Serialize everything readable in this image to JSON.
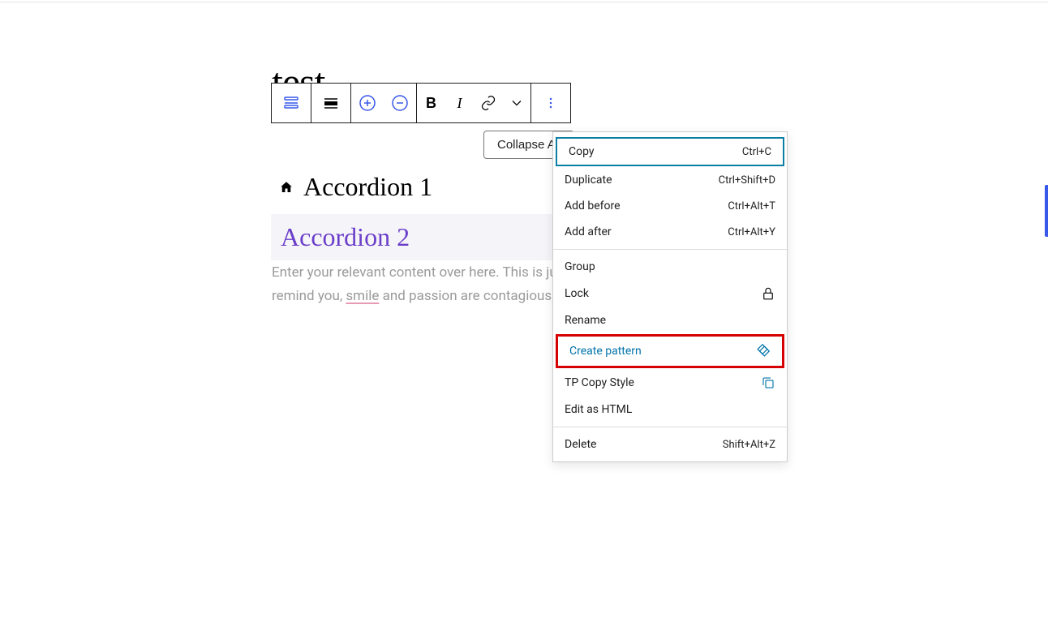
{
  "page": {
    "title": "test"
  },
  "toolbar": {
    "icons": [
      "block-type",
      "align",
      "add",
      "remove",
      "bold",
      "italic",
      "link",
      "dropdown",
      "more"
    ]
  },
  "collapse": {
    "label": "Collapse All"
  },
  "accordion1": {
    "label": "Accordion 1"
  },
  "accordion2": {
    "heading": "Accordion 2"
  },
  "content": {
    "text_before": "Enter your relevant content over here. This is ju",
    "text_line2_before": "remind you, ",
    "smile": "smile",
    "text_after": " and passion are contagious, b"
  },
  "menu": {
    "sections": [
      {
        "items": [
          {
            "label": "Copy",
            "shortcut": "Ctrl+C",
            "selected": true
          },
          {
            "label": "Duplicate",
            "shortcut": "Ctrl+Shift+D"
          },
          {
            "label": "Add before",
            "shortcut": "Ctrl+Alt+T"
          },
          {
            "label": "Add after",
            "shortcut": "Ctrl+Alt+Y"
          }
        ]
      },
      {
        "items": [
          {
            "label": "Group"
          },
          {
            "label": "Lock",
            "icon": "lock"
          },
          {
            "label": "Rename"
          },
          {
            "label": "Create pattern",
            "icon": "pattern",
            "highlighted": true
          },
          {
            "label": "TP Copy Style",
            "icon": "copy"
          },
          {
            "label": "Edit as HTML"
          }
        ]
      },
      {
        "items": [
          {
            "label": "Delete",
            "shortcut": "Shift+Alt+Z"
          }
        ]
      }
    ]
  }
}
